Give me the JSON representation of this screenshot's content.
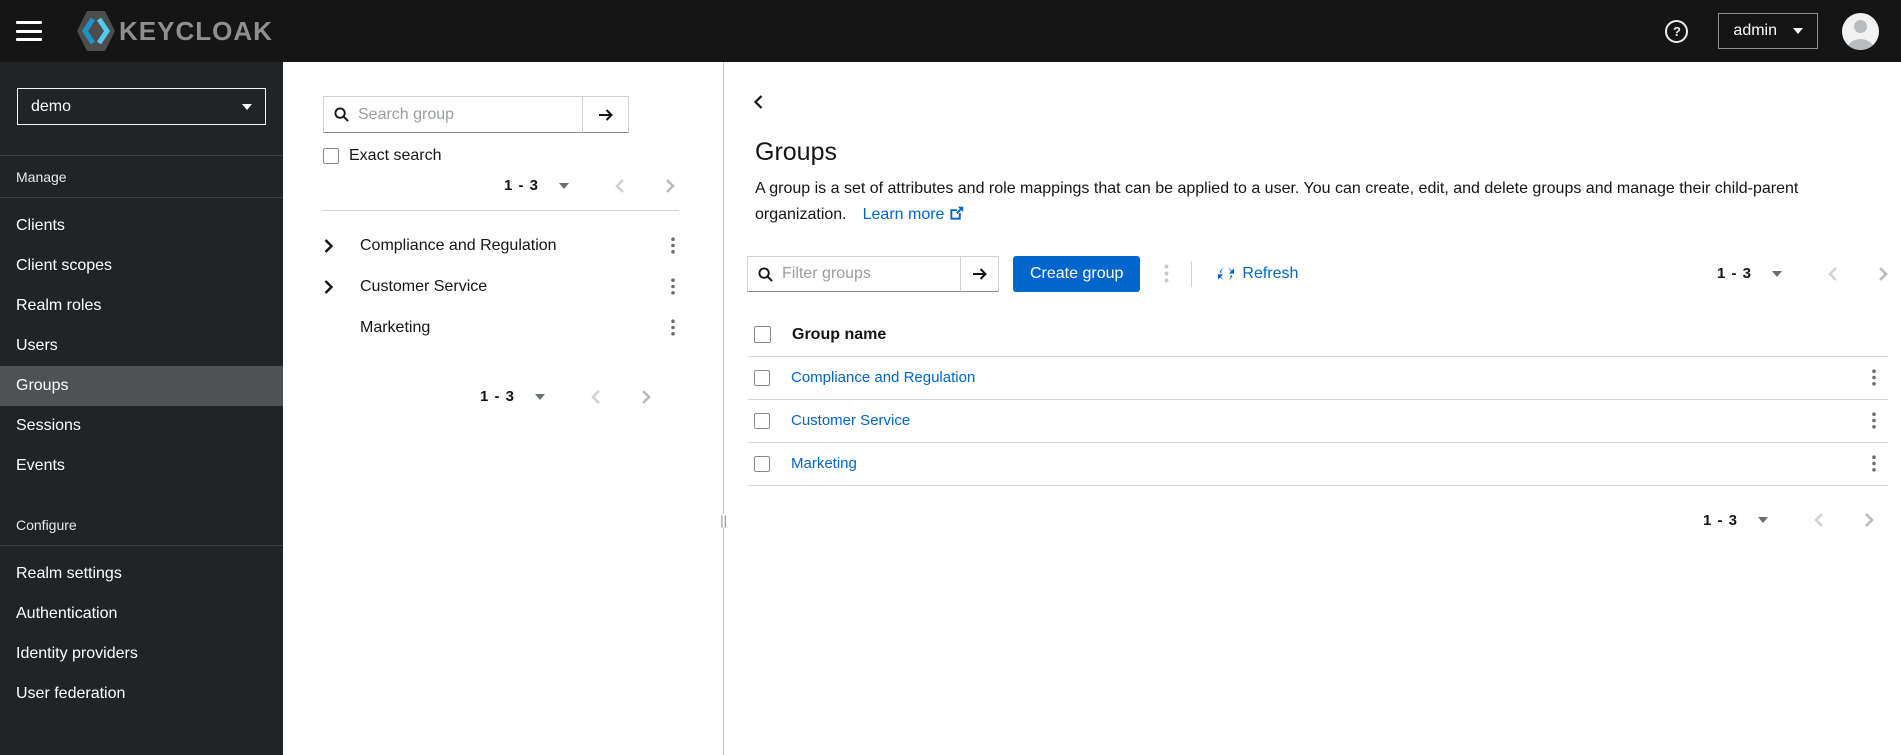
{
  "topbar": {
    "brand": "KEYCLOAK",
    "username": "admin"
  },
  "sidebar": {
    "realm": "demo",
    "manage": {
      "heading": "Manage",
      "items": [
        "Clients",
        "Client scopes",
        "Realm roles",
        "Users",
        "Groups",
        "Sessions",
        "Events"
      ]
    },
    "selected_item": "Groups",
    "configure": {
      "heading": "Configure",
      "items": [
        "Realm settings",
        "Authentication",
        "Identity providers",
        "User federation"
      ]
    }
  },
  "tree_panel": {
    "search_placeholder": "Search group",
    "exact_search_label": "Exact search",
    "pagination_top": "1 - 3",
    "pagination_bottom": "1 - 3",
    "items": [
      {
        "label": "Compliance and Regulation",
        "expandable": true
      },
      {
        "label": "Customer Service",
        "expandable": true
      },
      {
        "label": "Marketing",
        "expandable": false
      }
    ]
  },
  "main": {
    "title": "Groups",
    "description": "A group is a set of attributes and role mappings that can be applied to a user. You can create, edit, and delete groups and manage their child-parent organization.",
    "learn_more_label": "Learn more",
    "toolbar": {
      "filter_placeholder": "Filter groups",
      "create_button_label": "Create group",
      "refresh_label": "Refresh",
      "pagination": "1 - 3"
    },
    "table": {
      "header_group_name": "Group name",
      "rows": [
        {
          "name": "Compliance and Regulation"
        },
        {
          "name": "Customer Service"
        },
        {
          "name": "Marketing"
        }
      ]
    },
    "pagination_bottom": "1 - 3"
  },
  "colors": {
    "masthead_bg": "#151515",
    "sidebar_bg": "#212427",
    "sidebar_selected_bg": "#4f5255",
    "accent_blue": "#0066cc",
    "link_blue": "#0066cc",
    "border_gray": "#d2d2d2"
  }
}
